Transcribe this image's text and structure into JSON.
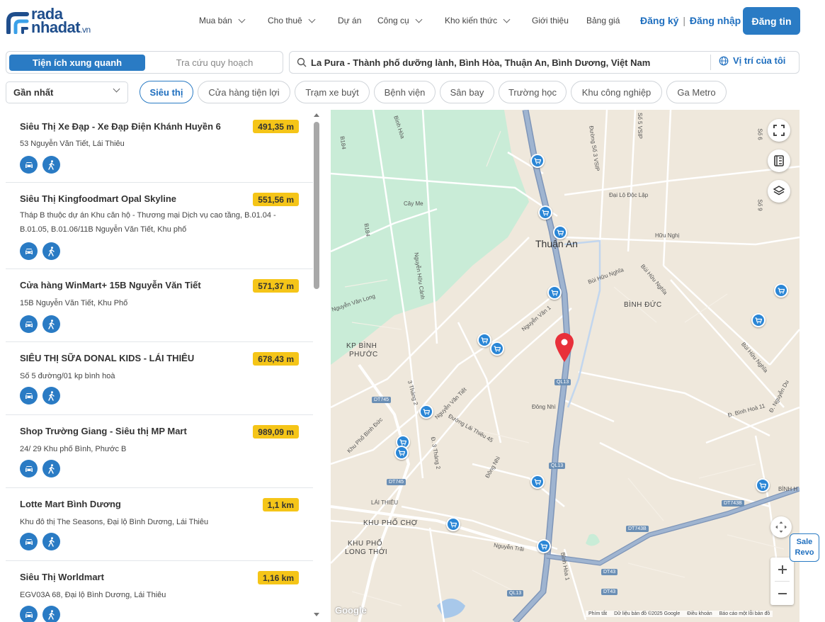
{
  "header": {
    "logo": {
      "line1": "rada",
      "line2": "nhadat",
      "suffix": ".vn"
    },
    "nav": [
      {
        "label": "Mua bán",
        "dropdown": true
      },
      {
        "label": "Cho thuê",
        "dropdown": true
      },
      {
        "label": "Dự án",
        "dropdown": false
      },
      {
        "label": "Công cụ",
        "dropdown": true
      },
      {
        "label": "Kho kiến thức",
        "dropdown": true
      },
      {
        "label": "Giới thiệu",
        "dropdown": false
      },
      {
        "label": "Bảng giá",
        "dropdown": false
      }
    ],
    "register": "Đăng ký",
    "login": "Đăng nhập",
    "auth_separator": "|",
    "post_button": "Đăng tin"
  },
  "tabs": {
    "active": "Tiện ích xung quanh",
    "inactive": "Tra cứu quy hoạch"
  },
  "search": {
    "value": "La Pura - Thành phố dưỡng lành, Bình Hòa, Thuận An, Bình Dương, Việt Nam",
    "location_button": "Vị trí của tôi"
  },
  "sort": {
    "selected": "Gần nhất"
  },
  "chips": [
    {
      "label": "Siêu thị",
      "active": true
    },
    {
      "label": "Cửa hàng tiện lợi",
      "active": false
    },
    {
      "label": "Trạm xe buýt",
      "active": false
    },
    {
      "label": "Bệnh viện",
      "active": false
    },
    {
      "label": "Sân bay",
      "active": false
    },
    {
      "label": "Trường học",
      "active": false
    },
    {
      "label": "Khu công nghiệp",
      "active": false
    },
    {
      "label": "Ga Metro",
      "active": false
    }
  ],
  "places": [
    {
      "name": "Siêu Thị Xe Đạp - Xe Đạp Điện Khánh Huyền 6",
      "distance": "491,35 m",
      "address": "53 Nguyễn Văn Tiết, Lái Thiêu"
    },
    {
      "name": "Siêu Thị Kingfoodmart Opal Skyline",
      "distance": "551,56 m",
      "address": "Tháp B thuộc dự án Khu căn hộ - Thương mại Dịch vụ cao tầng, B.01.04 - B.01.05, B.01.06/11B Nguyễn Văn Tiết, Khu phố"
    },
    {
      "name": "Cửa hàng WinMart+ 15B Nguyễn Văn Tiết",
      "distance": "571,37 m",
      "address": "15B Nguyễn Văn Tiết, Khu Phố"
    },
    {
      "name": "SIÊU THỊ SỮA DONAL KIDS - LÁI THIÊU",
      "distance": "678,43 m",
      "address": "Số 5 đường/01 kp bình hoà"
    },
    {
      "name": "Shop Trường Giang - Siêu thị MP Mart",
      "distance": "989,09 m",
      "address": "24/ 29 Khu phố Bình, Phước B"
    },
    {
      "name": "Lotte Mart Bình Dương",
      "distance": "1,1 km",
      "address": "Khu đô thị The Seasons, Đại lộ Bình Dương, Lái Thiêu"
    },
    {
      "name": "Siêu Thị Worldmart",
      "distance": "1,16 km",
      "address": "EGV03A 68, Đại lộ Bình Dương, Lái Thiêu"
    }
  ],
  "map": {
    "labels": {
      "thuan_an": "Thuận An",
      "binh_duc": "BÌNH ĐỨC",
      "kp_binh_phuoc_1": "KP BÌNH",
      "kp_binh_phuoc_2": "PHƯỚC",
      "lai_thieu": "LÁI THIÊU",
      "kp_cho": "KHU PHỐ CHỢ",
      "kp_long_thoi_1": "KHU PHỐ",
      "kp_long_thoi_2": "LONG THỚI",
      "cay_me": "Cây Me",
      "binh_hoa": "Bình Hòa",
      "nguyen_huu_canh": "Nguyễn Hữu Cảnh",
      "nguyen_van_long": "Nguyễn Văn Long",
      "nguyen_van_1": "Nguyễn Văn 1",
      "nguyen_van_tiet": "Nguyễn Văn Tiết",
      "duong_lai_thieu": "Đường Lái Thiêu 45",
      "dong_nhi": "Đông Nhì",
      "dong_nhi_2": "Đông Nhì",
      "nguyen_trai": "Nguyễn Trãi",
      "dai_lo_doc_lap": "Đại Lộ Độc Lập",
      "huu_nghi": "Hữu Nghị",
      "bui_huu_nghia": "Bùi Hữu Nghĩa",
      "bui_huu_nghia_2": "Bùi Hữu Nghĩa",
      "bui_huu_nghia_3": "Bùi Hữu Nghĩa",
      "duong_so_3_visp": "Đường Số 3 VSIP",
      "so_5_visp": "Số 5 VSIP",
      "d_binh_hoa_11": "Đ. Bình Hoà 11",
      "d_nguyen_du": "Đ. Nguyễn Du",
      "kp_binh_duc": "Khu Phố Bình Đức",
      "d_3_thang_2": "Đ. 3 Tháng 2",
      "t3_thang_2": "3 Tháng 2",
      "binh_hoa_1": "Bình Hòa 1",
      "b184": "B184",
      "b184_2": "B184",
      "so_6": "Số 6",
      "so_9": "Số 9",
      "binh_h": "BÌNH H"
    },
    "shields": {
      "ql13_a": "QL13",
      "ql13_b": "QL13",
      "ql13_c": "QL13",
      "dt745_a": "DT745",
      "dt745_b": "DT745",
      "dt743b_a": "DT743B",
      "dt743b_b": "DT743B",
      "dt43_a": "DT43",
      "dt43_b": "DT43"
    },
    "google_logo": "Google",
    "attribution": {
      "shortcuts": "Phím tắt",
      "data": "Dữ liệu bản đồ ©2025 Google",
      "terms": "Điều khoản",
      "report": "Báo cáo một lỗi bản đồ"
    }
  },
  "sale_badge": {
    "line1": "Sale",
    "line2": "Revo"
  },
  "colors": {
    "primary": "#2a7bc4",
    "distance_badge": "#f5c518",
    "pin": "#e8303a",
    "highway": "#8fa8c8"
  }
}
